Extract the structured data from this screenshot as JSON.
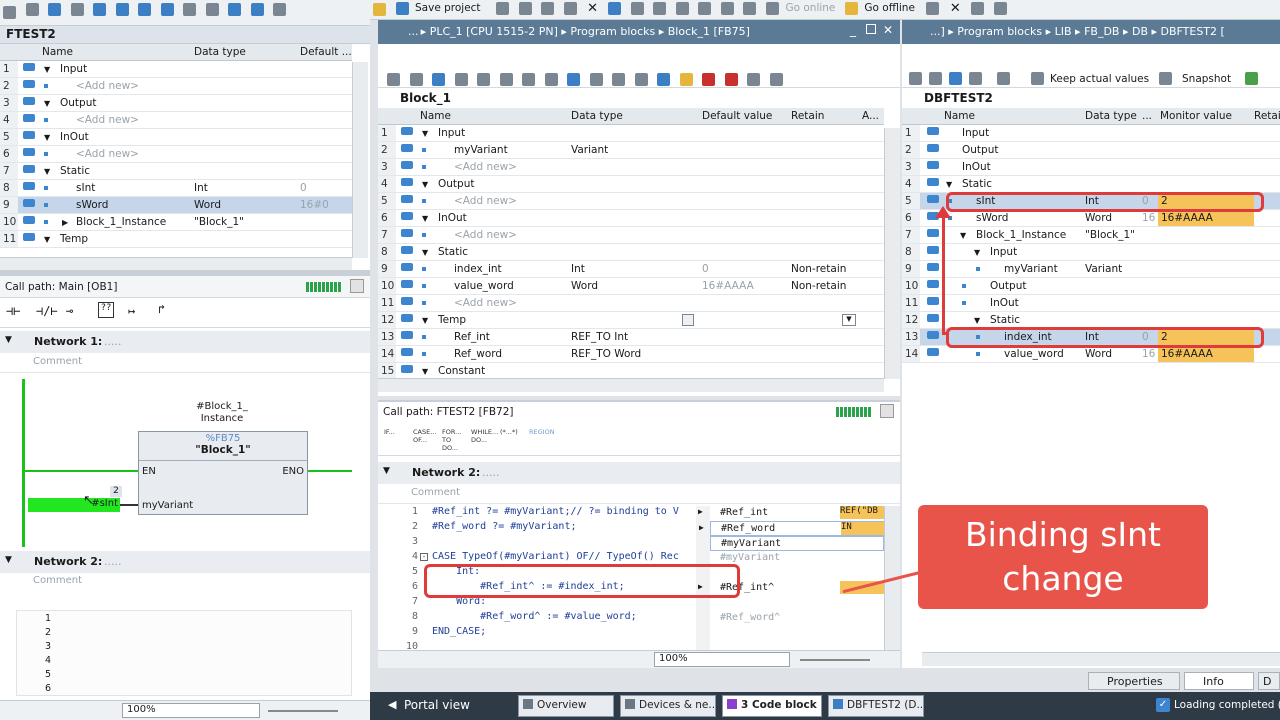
{
  "toolbar": {
    "save_label": "Save project",
    "go_online": "Go online",
    "go_offline": "Go offline"
  },
  "left_panel": {
    "title": "FTEST2",
    "headers": [
      "Name",
      "Data type",
      "Default ..."
    ],
    "rows": [
      {
        "n": "1",
        "name": "Input",
        "type": "",
        "def": ""
      },
      {
        "n": "2",
        "name": "<Add new>",
        "type": "",
        "def": ""
      },
      {
        "n": "3",
        "name": "Output",
        "type": "",
        "def": ""
      },
      {
        "n": "4",
        "name": "<Add new>",
        "type": "",
        "def": ""
      },
      {
        "n": "5",
        "name": "InOut",
        "type": "",
        "def": ""
      },
      {
        "n": "6",
        "name": "<Add new>",
        "type": "",
        "def": ""
      },
      {
        "n": "7",
        "name": "Static",
        "type": "",
        "def": ""
      },
      {
        "n": "8",
        "name": "sInt",
        "type": "Int",
        "def": "0"
      },
      {
        "n": "9",
        "name": "sWord",
        "type": "Word",
        "def": "16#0"
      },
      {
        "n": "10",
        "name": "Block_1_Instance",
        "type": "\"Block_1\"",
        "def": ""
      },
      {
        "n": "11",
        "name": "Temp",
        "type": "",
        "def": ""
      }
    ],
    "call_path": "Call path: Main [OB1]",
    "network1": "Network 1:",
    "network2": "Network 2:",
    "comment": "Comment",
    "block_instance_label": "#Block_1_ Instance",
    "block_fb": "%FB75",
    "block_name": "\"Block_1\"",
    "en": "EN",
    "eno": "ENO",
    "input_name": "myVariant",
    "sint_pin": "#sInt",
    "pin_value": "2",
    "ln_numbers": [
      "1",
      "2",
      "3",
      "4",
      "5",
      "6"
    ],
    "zoom": "100%"
  },
  "middle_panel": {
    "breadcrumb": "... ▸ PLC_1 [CPU 1515-2 PN] ▸ Program blocks ▸ Block_1 [FB75]",
    "title": "Block_1",
    "headers": [
      "Name",
      "Data type",
      "Default value",
      "Retain",
      "A..."
    ],
    "rows": [
      {
        "n": "1",
        "name": "Input",
        "type": "",
        "def": "",
        "ret": ""
      },
      {
        "n": "2",
        "name": "myVariant",
        "type": "Variant",
        "def": "",
        "ret": ""
      },
      {
        "n": "3",
        "name": "<Add new>",
        "type": "",
        "def": "",
        "ret": ""
      },
      {
        "n": "4",
        "name": "Output",
        "type": "",
        "def": "",
        "ret": ""
      },
      {
        "n": "5",
        "name": "<Add new>",
        "type": "",
        "def": "",
        "ret": ""
      },
      {
        "n": "6",
        "name": "InOut",
        "type": "",
        "def": "",
        "ret": ""
      },
      {
        "n": "7",
        "name": "<Add new>",
        "type": "",
        "def": "",
        "ret": ""
      },
      {
        "n": "8",
        "name": "Static",
        "type": "",
        "def": "",
        "ret": ""
      },
      {
        "n": "9",
        "name": "index_int",
        "type": "Int",
        "def": "0",
        "ret": "Non-retain"
      },
      {
        "n": "10",
        "name": "value_word",
        "type": "Word",
        "def": "16#AAAA",
        "ret": "Non-retain"
      },
      {
        "n": "11",
        "name": "<Add new>",
        "type": "",
        "def": "",
        "ret": ""
      },
      {
        "n": "12",
        "name": "Temp",
        "type": "",
        "def": "",
        "ret": ""
      },
      {
        "n": "13",
        "name": "Ref_int",
        "type": "REF_TO Int",
        "def": "",
        "ret": ""
      },
      {
        "n": "14",
        "name": "Ref_word",
        "type": "REF_TO Word",
        "def": "",
        "ret": ""
      },
      {
        "n": "15",
        "name": "Constant",
        "type": "",
        "def": "",
        "ret": ""
      }
    ],
    "call_path": "Call path: FTEST2 [FB72]",
    "instr": [
      "IF...",
      "CASE... OF...",
      "FOR... TO DO...",
      "WHILE... DO...",
      "(*...*)",
      "REGION"
    ],
    "network2": "Network 2:",
    "comment": "Comment",
    "code": [
      {
        "n": "1",
        "t": "#Ref_int ?= #myVariant;// ?= binding to V"
      },
      {
        "n": "2",
        "t": "#Ref_word ?= #myVariant;"
      },
      {
        "n": "3",
        "t": ""
      },
      {
        "n": "4",
        "t": "CASE TypeOf(#myVariant) OF// TypeOf() Rec"
      },
      {
        "n": "5",
        "t": "    Int:"
      },
      {
        "n": "6",
        "t": "        #Ref_int^ := #index_int;"
      },
      {
        "n": "7",
        "t": "    Word:"
      },
      {
        "n": "8",
        "t": "        #Ref_word^ := #value_word;"
      },
      {
        "n": "9",
        "t": "END_CASE;"
      },
      {
        "n": "10",
        "t": ""
      }
    ],
    "watch": [
      {
        "t": "#Ref_int",
        "v": "REF(\"DB"
      },
      {
        "t": "#Ref_word",
        "v": "IN"
      },
      {
        "t": "#myVariant",
        "v": ""
      },
      {
        "t": "#myVariant",
        "v": ""
      },
      {
        "t": "#Ref_int^",
        "v": ""
      },
      {
        "t": "#Ref_word^",
        "v": ""
      }
    ],
    "zoom": "100%"
  },
  "right_panel": {
    "breadcrumb": "...] ▸ Program blocks ▸ LIB ▸ FB_DB ▸ DB ▸ DBFTEST2 [",
    "keep_actual": "Keep actual values",
    "snapshot": "Snapshot",
    "title": "DBFTEST2",
    "headers": [
      "Name",
      "Data type",
      "...",
      "Monitor value",
      "Retai"
    ],
    "rows": [
      {
        "n": "1",
        "name": "Input",
        "type": "",
        "off": "",
        "mon": ""
      },
      {
        "n": "2",
        "name": "Output",
        "type": "",
        "off": "",
        "mon": ""
      },
      {
        "n": "3",
        "name": "InOut",
        "type": "",
        "off": "",
        "mon": ""
      },
      {
        "n": "4",
        "name": "Static",
        "type": "",
        "off": "",
        "mon": ""
      },
      {
        "n": "5",
        "name": "sInt",
        "type": "Int",
        "off": "0",
        "mon": "2"
      },
      {
        "n": "6",
        "name": "sWord",
        "type": "Word",
        "off": "16",
        "mon": "16#AAAA"
      },
      {
        "n": "7",
        "name": "Block_1_Instance",
        "type": "\"Block_1\"",
        "off": "",
        "mon": ""
      },
      {
        "n": "8",
        "name": "Input",
        "type": "",
        "off": "",
        "mon": ""
      },
      {
        "n": "9",
        "name": "myVariant",
        "type": "Variant",
        "off": "",
        "mon": ""
      },
      {
        "n": "10",
        "name": "Output",
        "type": "",
        "off": "",
        "mon": ""
      },
      {
        "n": "11",
        "name": "InOut",
        "type": "",
        "off": "",
        "mon": ""
      },
      {
        "n": "12",
        "name": "Static",
        "type": "",
        "off": "",
        "mon": ""
      },
      {
        "n": "13",
        "name": "index_int",
        "type": "Int",
        "off": "0",
        "mon": "2"
      },
      {
        "n": "14",
        "name": "value_word",
        "type": "Word",
        "off": "16",
        "mon": "16#AAAA"
      }
    ],
    "properties": "Properties",
    "info": "Info",
    "d": "D"
  },
  "callout": {
    "line1": "Binding sInt",
    "line2": "change"
  },
  "statusbar": {
    "portal": "Portal view",
    "tabs": [
      "Overview",
      "Devices & ne...",
      "3 Code block",
      "DBFTEST2 (D..."
    ],
    "loading": "Loading completed (er"
  }
}
